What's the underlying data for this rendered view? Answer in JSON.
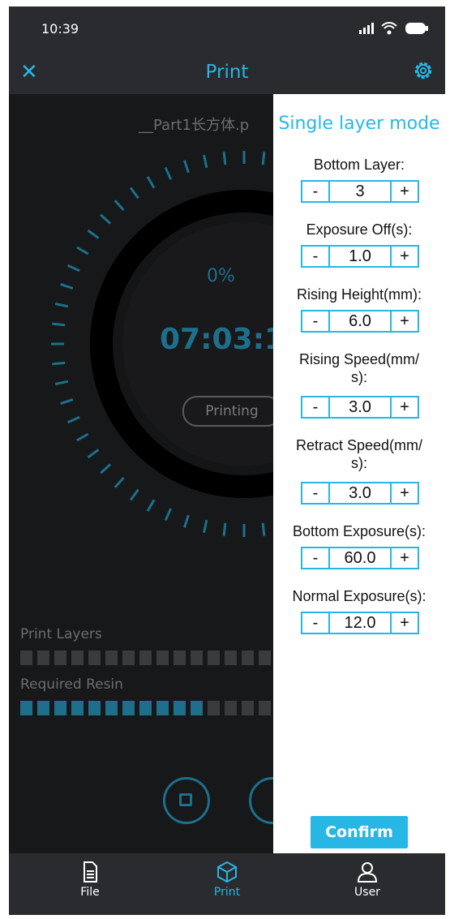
{
  "status_bar": {
    "time": "10:39",
    "icons": [
      "signal-icon",
      "wifi-icon",
      "battery-icon"
    ]
  },
  "app_bar": {
    "title": "Print",
    "close_icon": "close-icon",
    "settings_icon": "gear-icon"
  },
  "print_view": {
    "file_name": "__Part1长方体.p",
    "progress_percent": "0%",
    "remaining_time": "07:03:1",
    "status": "Printing",
    "print_layers_label": "Print Layers",
    "required_resin_label": "Required Resin",
    "print_layers_filled": 0,
    "required_resin_filled": 11
  },
  "settings_panel": {
    "title": "Single layer mode",
    "params": [
      {
        "label": "Bottom Layer:",
        "value": "3"
      },
      {
        "label": "Exposure Off(s):",
        "value": "1.0"
      },
      {
        "label": "Rising Height(mm):",
        "value": "6.0"
      },
      {
        "label": "Rising Speed(mm/\ns):",
        "value": "3.0"
      },
      {
        "label": "Retract Speed(mm/\ns):",
        "value": "3.0"
      },
      {
        "label": "Bottom Exposure(s):",
        "value": "60.0"
      },
      {
        "label": "Normal Exposure(s):",
        "value": "12.0"
      }
    ],
    "minus_label": "-",
    "plus_label": "+",
    "confirm_label": "Confirm"
  },
  "tab_bar": {
    "tabs": [
      {
        "label": "File",
        "icon": "file-icon",
        "active": false
      },
      {
        "label": "Print",
        "icon": "cube-icon",
        "active": true
      },
      {
        "label": "User",
        "icon": "user-icon",
        "active": false
      }
    ]
  },
  "colors": {
    "accent": "#26b7e5",
    "dim_accent": "#1d6f8c",
    "background": "#17181a",
    "bar": "#2a2b2f"
  }
}
